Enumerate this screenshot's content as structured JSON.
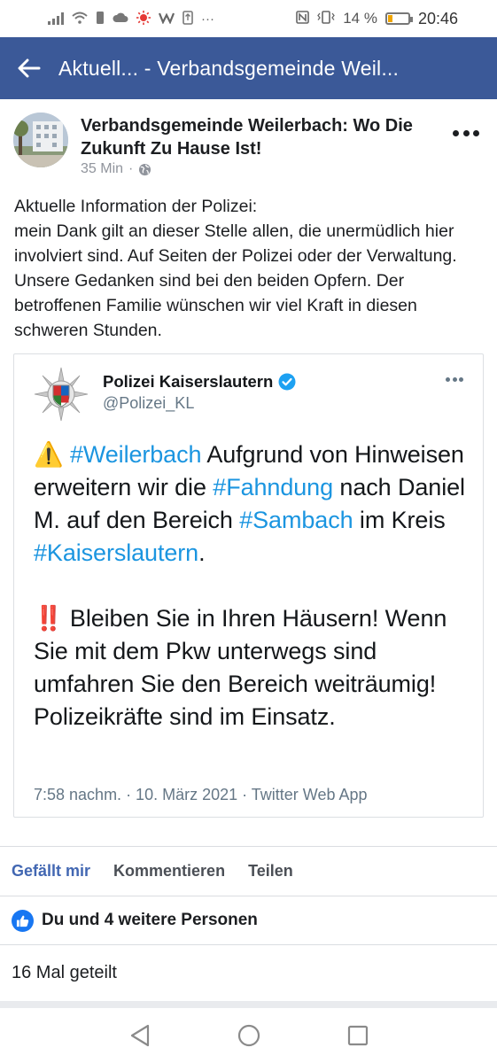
{
  "status_bar": {
    "dots": "···",
    "battery_percent": "14 %",
    "time": "20:46"
  },
  "app_bar": {
    "title": "Aktuell... - Verbandsgemeinde Weil..."
  },
  "post": {
    "page_name": "Verbandsgemeinde Weilerbach: Wo Die Zukunft Zu Hause Ist!",
    "time_ago": "35 Min",
    "meta_separator": "·",
    "text_lines": [
      "Aktuelle Information der Polizei:",
      "mein Dank gilt an dieser Stelle allen, die unermüdlich hier involviert sind. Auf Seiten der Polizei oder der Verwaltung. Unsere Gedanken sind bei den beiden Opfern. Der betroffenen Familie wünschen wir viel Kraft in diesen schweren Stunden."
    ]
  },
  "tweet": {
    "name": "Polizei Kaiserslautern",
    "handle": "@Polizei_KL",
    "para1": {
      "emoji": "⚠️",
      "tag1": "#Weilerbach",
      "t1": " Aufgrund von Hinweisen erweitern wir die ",
      "tag2": "#Fahndung",
      "t2": " nach Daniel M. auf den Bereich ",
      "tag3": "#Sambach",
      "t3": " im Kreis ",
      "tag4": "#Kaiserslautern",
      "t4": "."
    },
    "para2": {
      "emoji": "‼️",
      "text": " Bleiben Sie in Ihren Häusern! Wenn Sie mit dem Pkw unterwegs sind umfahren Sie den Bereich weiträumig! Polizeikräfte sind im Einsatz."
    },
    "footer": "7:58 nachm. · 10. März 2021 · Twitter Web App"
  },
  "actions": {
    "like": "Gefällt mir",
    "comment": "Kommentieren",
    "share": "Teilen"
  },
  "likes_summary": "Du und 4 weitere Personen",
  "shares_summary": "16 Mal geteilt",
  "colors": {
    "brand": "#3b5998",
    "hashtag": "#1b95e0",
    "like_active": "#4267b2"
  },
  "icons": {
    "back": "arrow-left-icon",
    "globe": "globe-icon",
    "verified": "verified-badge-icon",
    "like": "thumbs-up-icon",
    "nav_back": "triangle-back-icon",
    "nav_home": "circle-home-icon",
    "nav_recent": "square-recent-icon"
  }
}
